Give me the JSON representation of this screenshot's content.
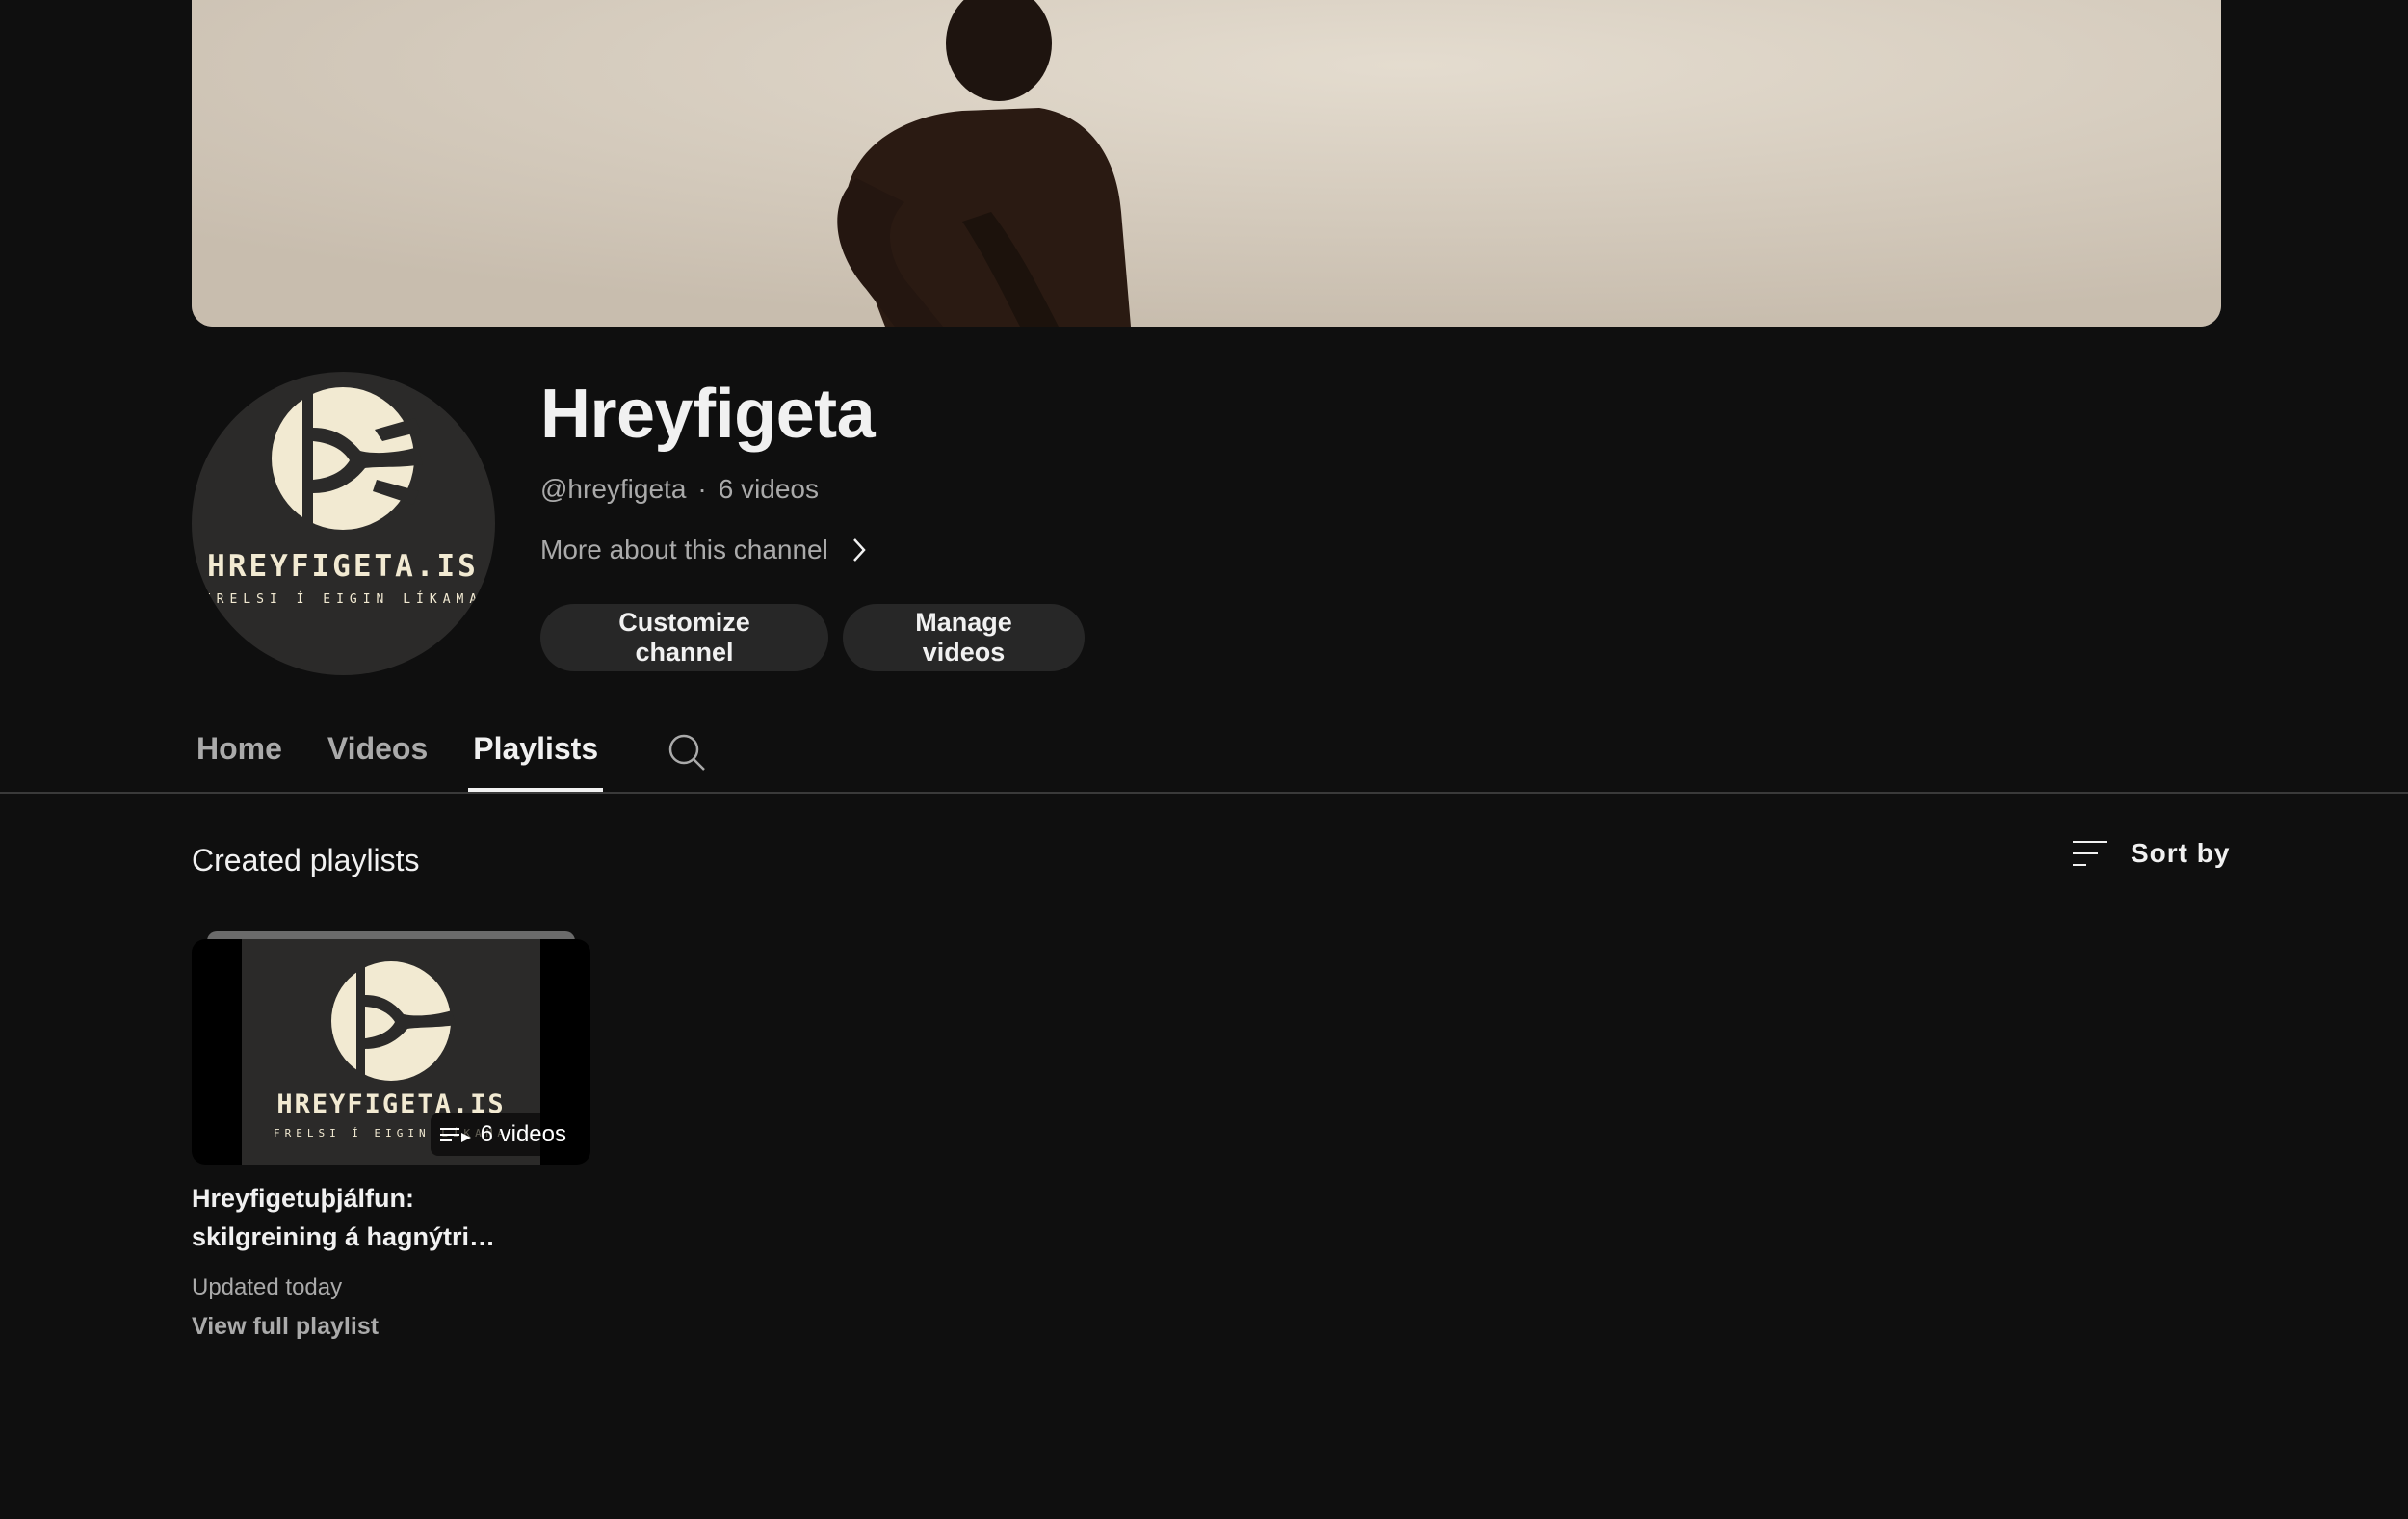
{
  "channel": {
    "name": "Hreyfigeta",
    "handle": "@hreyfigeta",
    "separator": "·",
    "video_count": "6 videos",
    "more_about": "More about this channel",
    "logo_text": "HREYFIGETA.IS",
    "logo_tagline": "FRELSI Í EIGIN LÍKAMA"
  },
  "actions": {
    "customize": "Customize channel",
    "manage": "Manage videos"
  },
  "tabs": [
    {
      "label": "Home",
      "active": false
    },
    {
      "label": "Videos",
      "active": false
    },
    {
      "label": "Playlists",
      "active": true
    }
  ],
  "icons": {
    "search": "search-icon",
    "sort": "sort-icon",
    "chevron": "chevron-right-icon",
    "playlist": "playlist-icon"
  },
  "section": {
    "title": "Created playlists",
    "sort_label": "Sort by"
  },
  "playlist": {
    "title_line1": "Hreyfigetuþjálfun:",
    "title_line2": "skilgreining á hagnýtri…",
    "count": "6 videos",
    "updated": "Updated today",
    "view_full": "View full playlist"
  },
  "colors": {
    "background": "#0f0f0f",
    "button_bg": "#272727",
    "text_primary": "#f1f1f1",
    "text_secondary": "#aaaaaa",
    "logo_cream": "#f2ead2",
    "avatar_bg": "#2b2a29"
  }
}
